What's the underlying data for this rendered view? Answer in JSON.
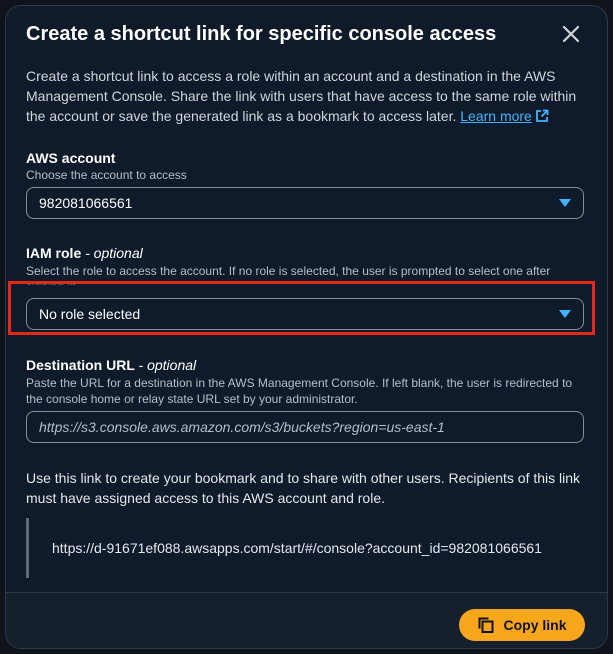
{
  "modal": {
    "title": "Create a shortcut link for specific console access",
    "description": "Create a shortcut link to access a role within an account and a destination in the AWS Management Console. Share the link with users that have access to the same role within the account or save the generated link as a bookmark to access later.",
    "learn_more": "Learn more"
  },
  "account": {
    "label": "AWS account",
    "hint": "Choose the account to access",
    "value": "982081066561"
  },
  "iam_role": {
    "label": "IAM role",
    "optional": "- optional",
    "hint": "Select the role to access the account. If no role is selected, the user is prompted to select one after signing in.",
    "value": "No role selected"
  },
  "destination": {
    "label": "Destination URL",
    "optional": "- optional",
    "hint": "Paste the URL for a destination in the AWS Management Console. If left blank, the user is redirected to the console home or relay state URL set by your administrator.",
    "placeholder": "https://s3.console.aws.amazon.com/s3/buckets?region=us-east-1"
  },
  "info": {
    "text": "Use this link to create your bookmark and to share with other users. Recipients of this link must have assigned access to this AWS account and role.",
    "link": "https://d-91671ef088.awsapps.com/start/#/console?account_id=982081066561"
  },
  "footer": {
    "copy_label": "Copy link"
  },
  "colors": {
    "background": "#0f1b2a",
    "accent": "#42b4ff",
    "primary_button": "#f8a61c",
    "highlight": "#e8271b"
  }
}
